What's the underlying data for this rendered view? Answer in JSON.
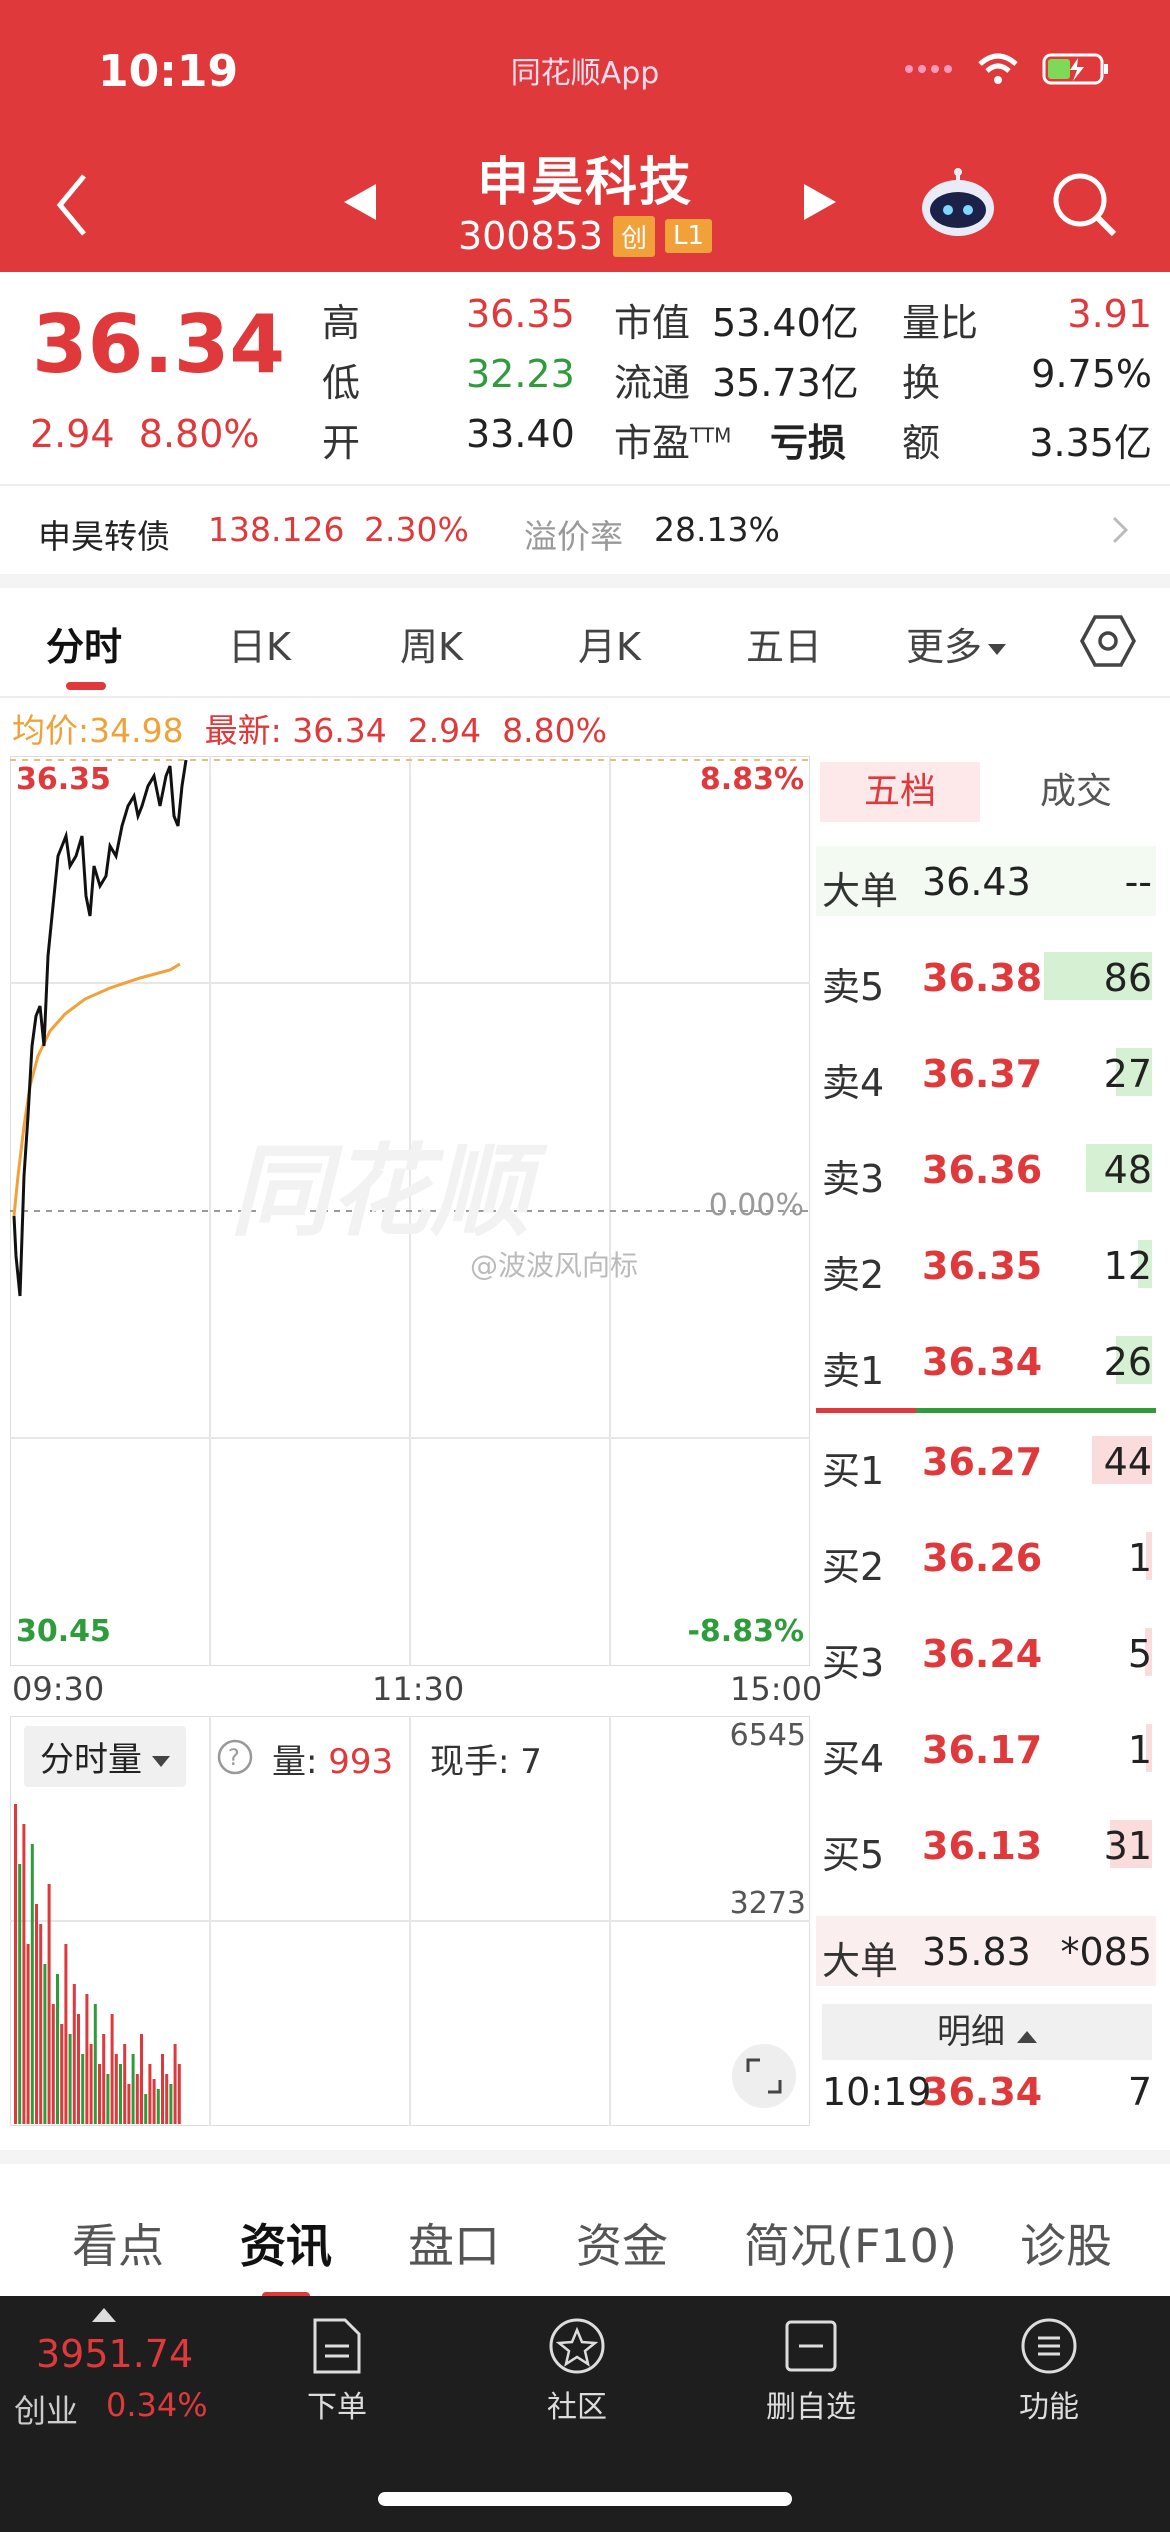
{
  "status": {
    "time": "10:19",
    "app": "同花顺App"
  },
  "header": {
    "title": "申昊科技",
    "code": "300853",
    "badge1": "创",
    "badge2": "L1"
  },
  "quote": {
    "price": "36.34",
    "change": "2.94",
    "change_pct": "8.80%",
    "high_label": "高",
    "high": "36.35",
    "low_label": "低",
    "low": "32.23",
    "open_label": "开",
    "open": "33.40",
    "mktcap_label": "市值",
    "mktcap": "53.40亿",
    "float_label": "流通",
    "float": "35.73亿",
    "pe_label": "市盈",
    "pe_sup": "TTM",
    "pe": "亏损",
    "vr_label": "量比",
    "vr": "3.91",
    "turnover_label": "换",
    "turnover": "9.75%",
    "amount_label": "额",
    "amount": "3.35亿"
  },
  "bond": {
    "name": "申昊转债",
    "price": "138.126",
    "pct": "2.30%",
    "premium_label": "溢价率",
    "premium": "28.13%"
  },
  "tabs": [
    "分时",
    "日K",
    "周K",
    "月K",
    "五日",
    "更多"
  ],
  "intraday": {
    "avg_label": "均价:",
    "avg": "34.98",
    "latest_label": "最新:",
    "latest": "36.34",
    "latest_chg": "2.94",
    "latest_pct": "8.80%",
    "top_price": "36.35",
    "top_pct": "8.83%",
    "mid_pct": "0.00%",
    "bottom_price": "30.45",
    "bottom_pct": "-8.83%",
    "times": [
      "09:30",
      "11:30",
      "15:00"
    ],
    "watermark": "@波波风向标"
  },
  "volume": {
    "selector": "分时量",
    "vol_label": "量:",
    "vol": "993",
    "hand_label": "现手:",
    "hand": "7",
    "max": "6545",
    "mid": "3273"
  },
  "book": {
    "tab_active": "五档",
    "tab_other": "成交",
    "big_top": {
      "label": "大单",
      "price": "36.43",
      "vol": "--"
    },
    "asks": [
      {
        "label": "卖5",
        "price": "36.38",
        "vol": "86",
        "fill": 0.9
      },
      {
        "label": "卖4",
        "price": "36.37",
        "vol": "27",
        "fill": 0.3
      },
      {
        "label": "卖3",
        "price": "36.36",
        "vol": "48",
        "fill": 0.55
      },
      {
        "label": "卖2",
        "price": "36.35",
        "vol": "12",
        "fill": 0.12
      },
      {
        "label": "卖1",
        "price": "36.34",
        "vol": "26",
        "fill": 0.3
      }
    ],
    "bids": [
      {
        "label": "买1",
        "price": "36.27",
        "vol": "44",
        "fill": 0.5
      },
      {
        "label": "买2",
        "price": "36.26",
        "vol": "1",
        "fill": 0.02
      },
      {
        "label": "买3",
        "price": "36.24",
        "vol": "5",
        "fill": 0.06
      },
      {
        "label": "买4",
        "price": "36.17",
        "vol": "1",
        "fill": 0.02
      },
      {
        "label": "买5",
        "price": "36.13",
        "vol": "31",
        "fill": 0.35
      }
    ],
    "big_bottom": {
      "label": "大单",
      "price": "35.83",
      "vol": "*085"
    },
    "detail_label": "明细",
    "last_trade": {
      "time": "10:19",
      "price": "36.34",
      "vol": "7"
    }
  },
  "bottom_tabs": [
    "看点",
    "资讯",
    "盘口",
    "资金",
    "简况(F10)",
    "诊股"
  ],
  "footer": {
    "index_value": "3951.74",
    "index_name": "创业",
    "index_pct": "0.34%",
    "buttons": [
      "下单",
      "社区",
      "删自选",
      "功能"
    ]
  },
  "colors": {
    "red": "#e0393b",
    "green": "#2e9c3a",
    "avg": "#f0a13a"
  }
}
